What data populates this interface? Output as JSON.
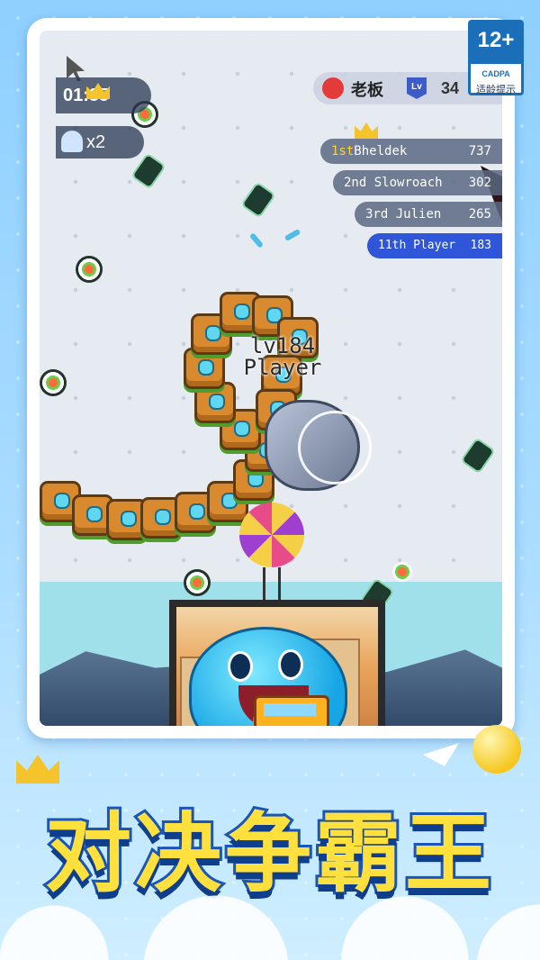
{
  "age_rating": {
    "label": "12+",
    "org": "CADPA",
    "tip": "适龄提示"
  },
  "hud": {
    "timer": "01:35",
    "multiplier": "x2",
    "boss_label": "老板",
    "level_badge": "Lv",
    "level_value": "34"
  },
  "leaderboard": [
    {
      "rank": "1st",
      "name": "Bheldek",
      "score": "737"
    },
    {
      "rank": "2nd",
      "name": "Slowroach",
      "score": "302"
    },
    {
      "rank": "3rd",
      "name": "Julien",
      "score": "265"
    },
    {
      "rank": "11th",
      "name": "Player",
      "score": "183"
    }
  ],
  "player": {
    "level": "lv184",
    "name": "Player"
  },
  "banner": {
    "title": "对决争霸王"
  },
  "colors": {
    "accent": "#2f56d8",
    "crown": "#f5c32c",
    "title_fill": "#ffe03c",
    "title_stroke": "#1a56b8"
  }
}
